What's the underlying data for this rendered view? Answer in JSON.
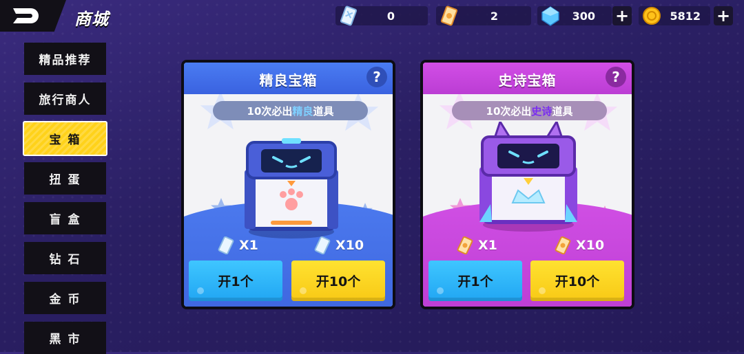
{
  "header": {
    "title": "商城",
    "currencies": [
      {
        "icon": "blue-ticket-icon",
        "value": "0"
      },
      {
        "icon": "gold-ticket-icon",
        "value": "2"
      },
      {
        "icon": "diamond-icon",
        "value": "300"
      },
      {
        "icon": "gold-coin-icon",
        "value": "5812"
      }
    ],
    "plus": "+"
  },
  "sidebar": {
    "items": [
      {
        "label": "精品推荐",
        "active": false
      },
      {
        "label": "旅行商人",
        "active": false
      },
      {
        "label": "宝 箱",
        "active": true
      },
      {
        "label": "扭 蛋",
        "active": false
      },
      {
        "label": "盲 盒",
        "active": false
      },
      {
        "label": "钻 石",
        "active": false
      },
      {
        "label": "金 币",
        "active": false
      },
      {
        "label": "黑 市",
        "active": false
      }
    ]
  },
  "cards": [
    {
      "title": "精良宝箱",
      "help": "?",
      "tag_prefix": "10次必出",
      "tag_highlight": "精良",
      "tag_suffix": "道具",
      "price_one": "X1",
      "price_ten": "X10",
      "open_one": "开1个",
      "open_ten": "开10个",
      "accent": "#3e6be8"
    },
    {
      "title": "史诗宝箱",
      "help": "?",
      "tag_prefix": "10次必出",
      "tag_highlight": "史诗",
      "tag_suffix": "道具",
      "price_one": "X1",
      "price_ten": "X10",
      "open_one": "开1个",
      "open_ten": "开10个",
      "accent": "#c43fd8"
    }
  ]
}
